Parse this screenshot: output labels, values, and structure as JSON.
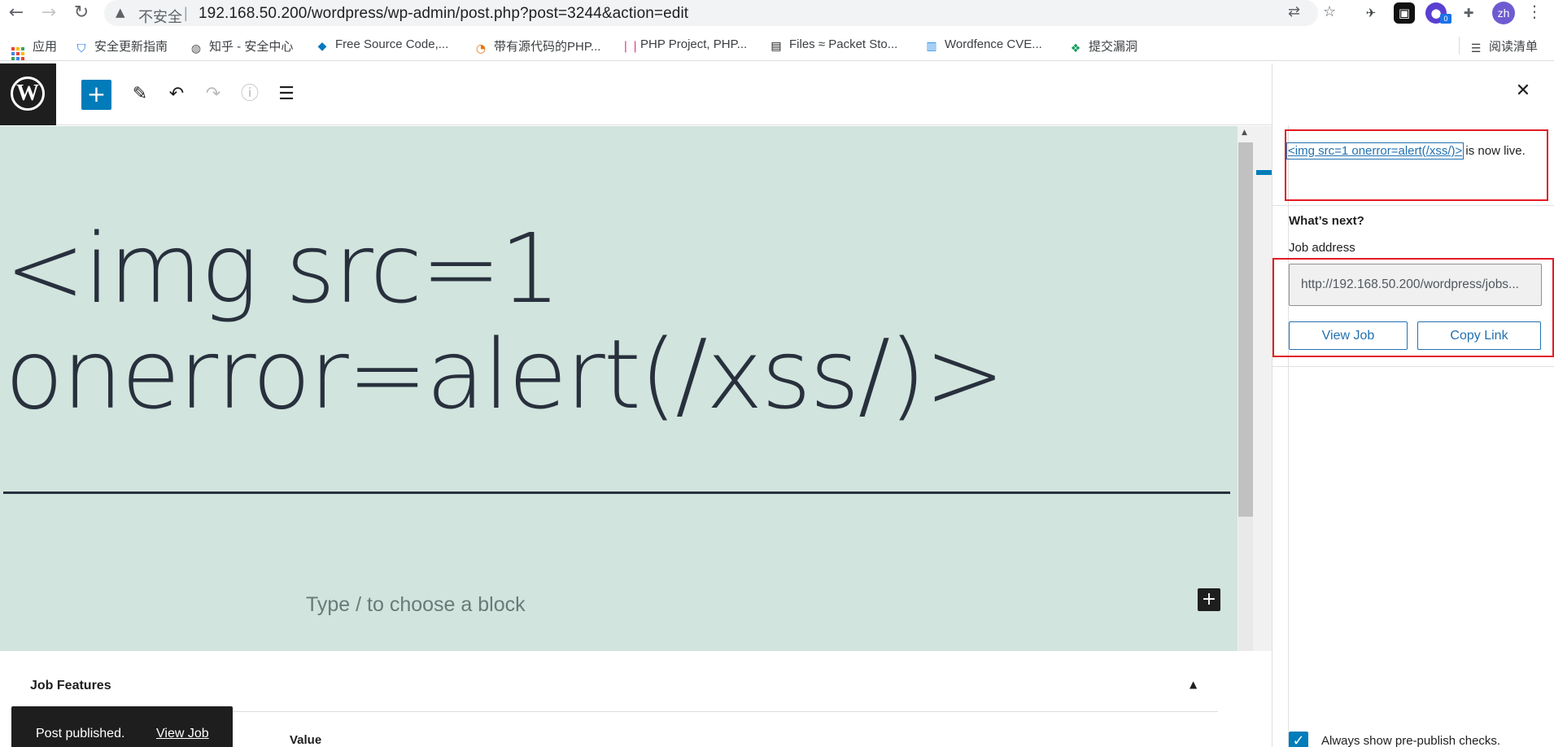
{
  "browser": {
    "insecure_label": "不安全",
    "separator": "|",
    "url": "192.168.50.200/wordpress/wp-admin/post.php?post=3244&action=edit",
    "ext_badge": "0",
    "profile": "zh",
    "bookmarks": [
      {
        "label": "应用",
        "icon": "apps-grid-icon"
      },
      {
        "label": "安全更新指南",
        "icon": "shield-icon"
      },
      {
        "label": "知乎 - 安全中心",
        "icon": "globe-icon"
      },
      {
        "label": "Free Source Code,...",
        "icon": "drupal-icon"
      },
      {
        "label": "带有源代码的PHP...",
        "icon": "pie-icon"
      },
      {
        "label": "PHP Project, PHP...",
        "icon": "books-icon"
      },
      {
        "label": "Files ≈ Packet Sto...",
        "icon": "ps-icon"
      },
      {
        "label": "Wordfence CVE...",
        "icon": "wordfence-icon"
      },
      {
        "label": "提交漏洞",
        "icon": "submit-icon"
      }
    ],
    "reading_list": "阅读清单"
  },
  "editor": {
    "post_title_line1": "<img src=1",
    "post_title_line2": "onerror=alert(/xss/)>",
    "block_placeholder": "Type / to choose a block"
  },
  "meta_box": {
    "title": "Job Features",
    "column_value": "Value"
  },
  "snackbar": {
    "text": "Post published.",
    "link": "View Job"
  },
  "sidebar": {
    "live_link": "<img src=1 onerror=alert(/xss/)>",
    "live_suffix": " is now live.",
    "whats_next": "What’s next?",
    "address_label": "Job address",
    "address_value": "http://192.168.50.200/wordpress/jobs...",
    "view_button": "View Job",
    "copy_button": "Copy Link",
    "checkbox_label": "Always show pre-publish checks."
  },
  "colors": {
    "canvas_bg": "#d1e4dd",
    "wp_blue": "#007cba",
    "annotation_red": "#e31b23"
  }
}
